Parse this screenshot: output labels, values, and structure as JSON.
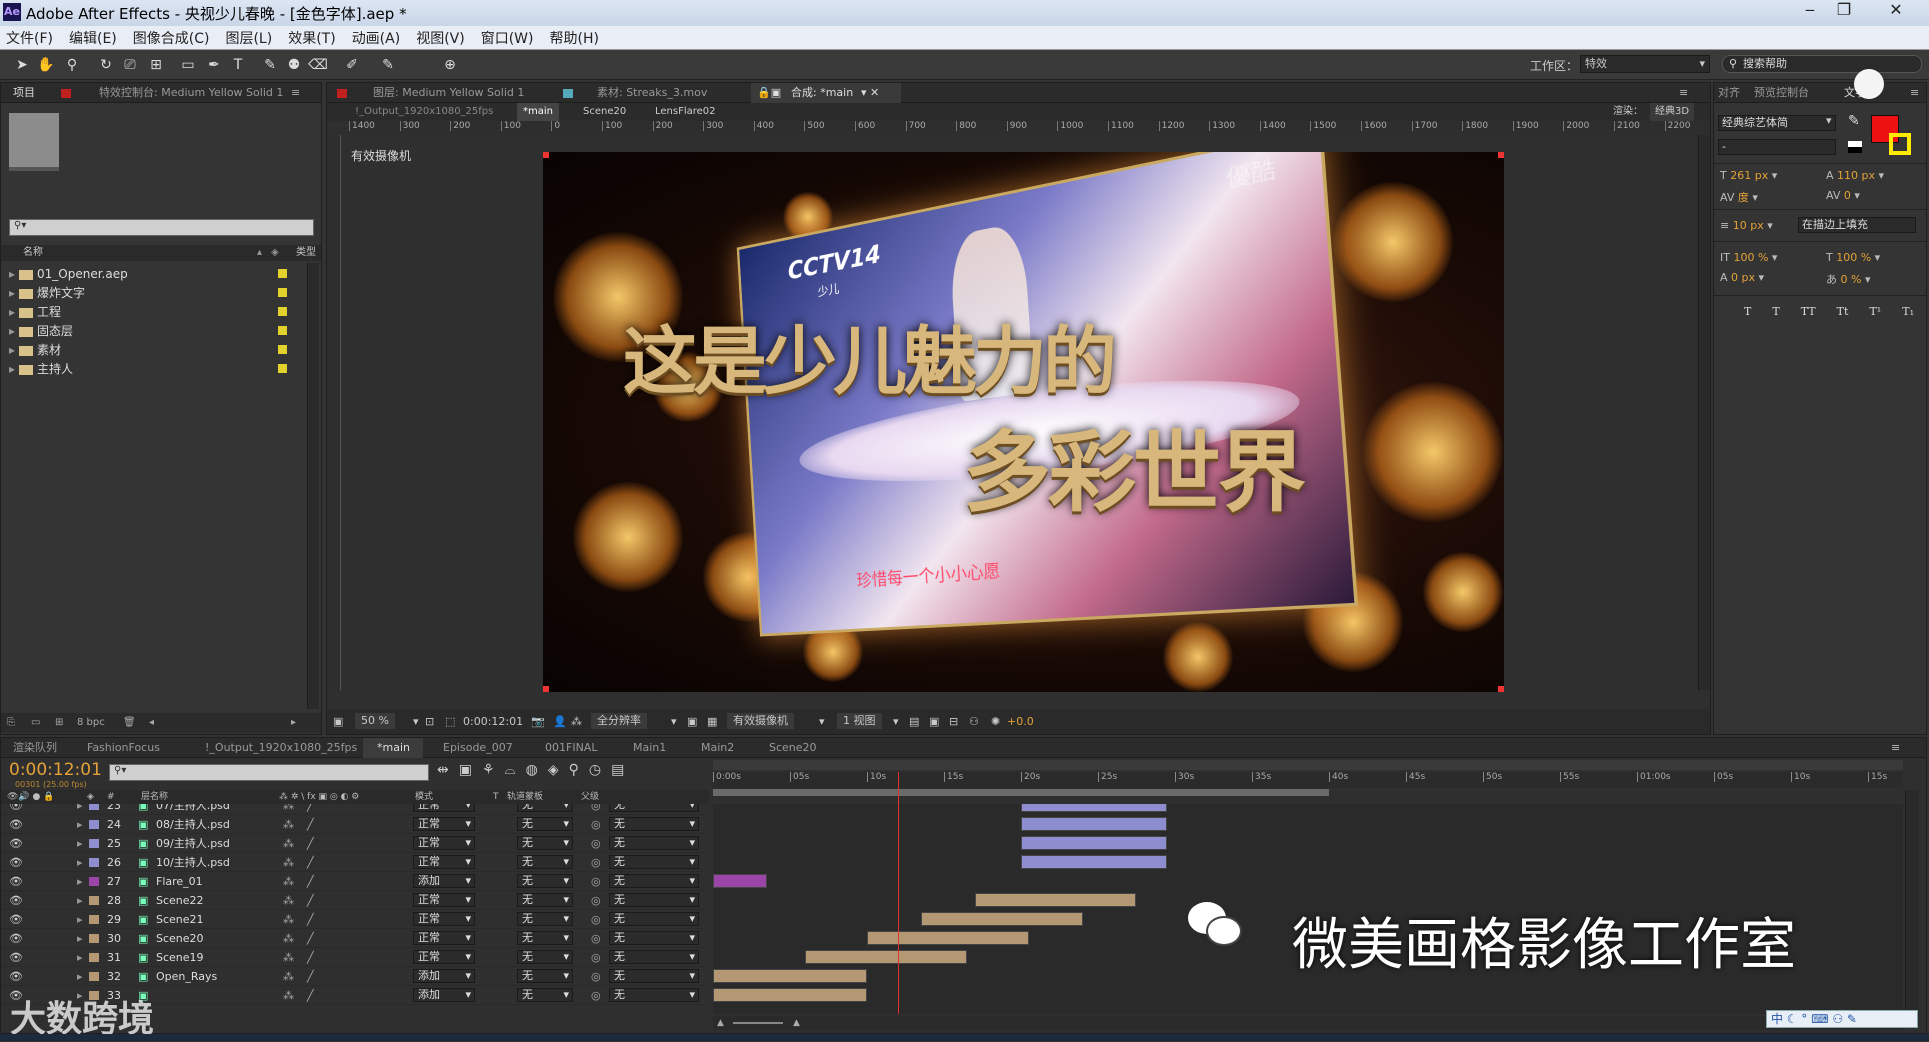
{
  "window": {
    "title": "Adobe After Effects - 央视少儿春晚 - [金色字体].aep *",
    "logo": "Ae",
    "min": "‒",
    "max": "❐",
    "close": "✕"
  },
  "menu": [
    "文件(F)",
    "编辑(E)",
    "图像合成(C)",
    "图层(L)",
    "效果(T)",
    "动画(A)",
    "视图(V)",
    "窗口(W)",
    "帮助(H)"
  ],
  "toolbar": {
    "workspace_label": "工作区：",
    "workspace_value": "特效",
    "search_placeholder": "搜索帮助"
  },
  "project_panel": {
    "tab_project": "项目",
    "tab_effects": "特效控制台: Medium Yellow Solid 1",
    "col_name": "名称",
    "col_type": "类型",
    "bpc": "8 bpc",
    "items": [
      "01_Opener.aep",
      "爆炸文字",
      "工程",
      "固态层",
      "素材",
      "主持人"
    ]
  },
  "comp_panel": {
    "tab_layer": "图层: Medium Yellow Solid 1",
    "tab_footage": "素材: Streaks_3.mov",
    "tab_comp": "合成: *main",
    "breadcrumbs": [
      "!_Output_1920x1080_25fps",
      "*main",
      "Scene20",
      "LensFlare02"
    ],
    "renderer_label": "渲染：",
    "renderer_value": "经典3D",
    "camera_label": "有效摄像机",
    "ruler_ticks": [
      "1400",
      "300",
      "200",
      "100",
      "0",
      "100",
      "200",
      "300",
      "400",
      "500",
      "600",
      "700",
      "800",
      "900",
      "1000",
      "1100",
      "1200",
      "1300",
      "1400",
      "1500",
      "1600",
      "1700",
      "1800",
      "1900",
      "2000",
      "2100",
      "2200",
      "230"
    ],
    "zoom": "50 %",
    "timecode": "0:00:12:01",
    "resolution": "全分辨率",
    "view_camera": "有效摄像机",
    "view_count": "1 视图",
    "exposure": "+0.0",
    "headline_1": "这是少儿魅力的",
    "headline_2": "多彩世界",
    "channel_logo": "CCTV14",
    "channel_sub": "少儿",
    "scroll_text": "珍惜每一个小小心愿",
    "watermark_tr": "優酷"
  },
  "char_panel": {
    "tab_align": "对齐",
    "tab_preview": "预览控制台",
    "tab_char": "文字",
    "font": "经典综艺体简",
    "style": "-",
    "size": "261 px",
    "leading": "110 px",
    "kerning": "度",
    "tracking": "0",
    "stroke_width": "10 px",
    "stroke_mode": "在描边上填充",
    "vscale": "100 %",
    "hscale": "100 %",
    "baseline": "0 px",
    "tsume": "0 %",
    "text_styles": [
      "T",
      "T",
      "TT",
      "Tt",
      "T¹",
      "T₁"
    ],
    "accent_color": "#ee1111"
  },
  "timeline": {
    "tabs": [
      "渲染队列",
      "FashionFocus",
      "!_Output_1920x1080_25fps",
      "*main",
      "Episode_007",
      "001FINAL",
      "Main1",
      "Main2",
      "Scene20"
    ],
    "current_time": "0:00:12:01",
    "frame_info": "00301 (25.00 fps)",
    "col_layer": "层名称",
    "col_mode": "模式",
    "col_t": "T",
    "col_trkmat": "轨道蒙板",
    "col_parent": "父级",
    "ruler": [
      "0:00s",
      "05s",
      "10s",
      "15s",
      "20s",
      "25s",
      "30s",
      "35s",
      "40s",
      "45s",
      "50s",
      "55s",
      "01:00s",
      "05s",
      "10s",
      "15s"
    ],
    "rows": [
      {
        "num": "23",
        "name": "07/主持人.psd",
        "mode": "正常",
        "trk": "无",
        "parent": "无",
        "color": "#8d8dd0",
        "bar_start": 20,
        "bar_end": 29.5
      },
      {
        "num": "24",
        "name": "08/主持人.psd",
        "mode": "正常",
        "trk": "无",
        "parent": "无",
        "color": "#8d8dd0",
        "bar_start": 20,
        "bar_end": 29.5
      },
      {
        "num": "25",
        "name": "09/主持人.psd",
        "mode": "正常",
        "trk": "无",
        "parent": "无",
        "color": "#8d8dd0",
        "bar_start": 20,
        "bar_end": 29.5
      },
      {
        "num": "26",
        "name": "10/主持人.psd",
        "mode": "正常",
        "trk": "无",
        "parent": "无",
        "color": "#8d8dd0",
        "bar_start": 20,
        "bar_end": 29.5
      },
      {
        "num": "27",
        "name": "Flare_01",
        "mode": "添加",
        "trk": "无",
        "parent": "无",
        "color": "#9b45a8",
        "bar_start": 0,
        "bar_end": 3.5
      },
      {
        "num": "28",
        "name": "Scene22",
        "mode": "正常",
        "trk": "无",
        "parent": "无",
        "color": "#b39873",
        "bar_start": 17,
        "bar_end": 27.5
      },
      {
        "num": "29",
        "name": "Scene21",
        "mode": "正常",
        "trk": "无",
        "parent": "无",
        "color": "#b39873",
        "bar_start": 13.5,
        "bar_end": 24
      },
      {
        "num": "30",
        "name": "Scene20",
        "mode": "正常",
        "trk": "无",
        "parent": "无",
        "color": "#b39873",
        "bar_start": 10,
        "bar_end": 20.5
      },
      {
        "num": "31",
        "name": "Scene19",
        "mode": "正常",
        "trk": "无",
        "parent": "无",
        "color": "#b39873",
        "bar_start": 6,
        "bar_end": 16.5
      },
      {
        "num": "32",
        "name": "Open_Rays",
        "mode": "添加",
        "trk": "无",
        "parent": "无",
        "color": "#b39873",
        "bar_start": 0,
        "bar_end": 10
      },
      {
        "num": "33",
        "name": "",
        "mode": "添加",
        "trk": "无",
        "parent": "无",
        "color": "#b39873",
        "bar_start": 0,
        "bar_end": 10
      }
    ],
    "work_area_end_sec": 40,
    "playhead_sec": 12.04
  },
  "overlays": {
    "wechat": "微美画格影像工作室",
    "brand": "大数跨境",
    "ime": "中"
  }
}
